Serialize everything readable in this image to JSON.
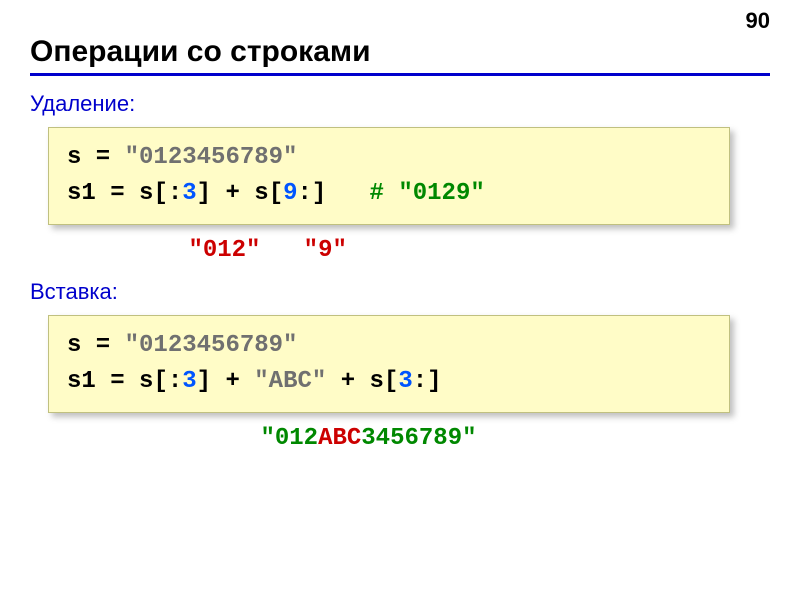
{
  "page_number": "90",
  "title": "Операции со строками",
  "sections": {
    "deletion": {
      "label": "Удаление:",
      "code": {
        "line1_s": "s",
        "line1_eq": " = ",
        "line1_str": "\"0123456789\"",
        "line2_s1": "s1",
        "line2_eq1": " = ",
        "line2_s2": "s",
        "line2_bracket1": "[:",
        "line2_num1": "3",
        "line2_bracket2": "]",
        "line2_plus": " + ",
        "line2_s3": "s",
        "line2_bracket3": "[",
        "line2_num2": "9",
        "line2_bracket4": ":]",
        "line2_gap": "   ",
        "line2_comment": "# \"0129\""
      },
      "annotation": {
        "indent": "           ",
        "part1": "\"012\"",
        "gap": "   ",
        "part2": "\"9\""
      }
    },
    "insertion": {
      "label": "Вставка:",
      "code": {
        "line1_s": "s",
        "line1_eq": " = ",
        "line1_str": "\"0123456789\"",
        "line2_s1": "s1",
        "line2_eq1": " = ",
        "line2_s2": "s",
        "line2_bracket1": "[:",
        "line2_num1": "3",
        "line2_bracket2": "]",
        "line2_plus1": " + ",
        "line2_abc": "\"ABC\"",
        "line2_plus2": " + ",
        "line2_s3": "s",
        "line2_bracket3": "[",
        "line2_num2": "3",
        "line2_bracket4": ":]"
      },
      "result": {
        "indent": "                ",
        "quote1": "\"",
        "part1": "012",
        "part_abc": "ABC",
        "part2": "3456789",
        "quote2": "\""
      }
    }
  }
}
